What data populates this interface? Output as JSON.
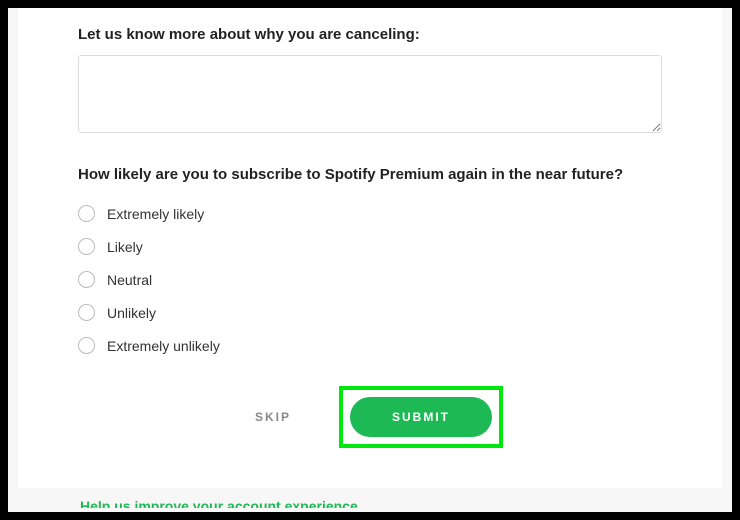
{
  "form": {
    "reason_label": "Let us know more about why you are canceling:",
    "reason_value": "",
    "likelihood_label": "How likely are you to subscribe to Spotify Premium again in the near future?",
    "options": {
      "0": "Extremely likely",
      "1": "Likely",
      "2": "Neutral",
      "3": "Unlikely",
      "4": "Extremely unlikely"
    }
  },
  "actions": {
    "skip_label": "SKIP",
    "submit_label": "SUBMIT"
  },
  "footer": {
    "link_text": "Help us improve your account experience"
  },
  "colors": {
    "brand_green": "#1db954",
    "highlight_green": "#00e60f"
  }
}
